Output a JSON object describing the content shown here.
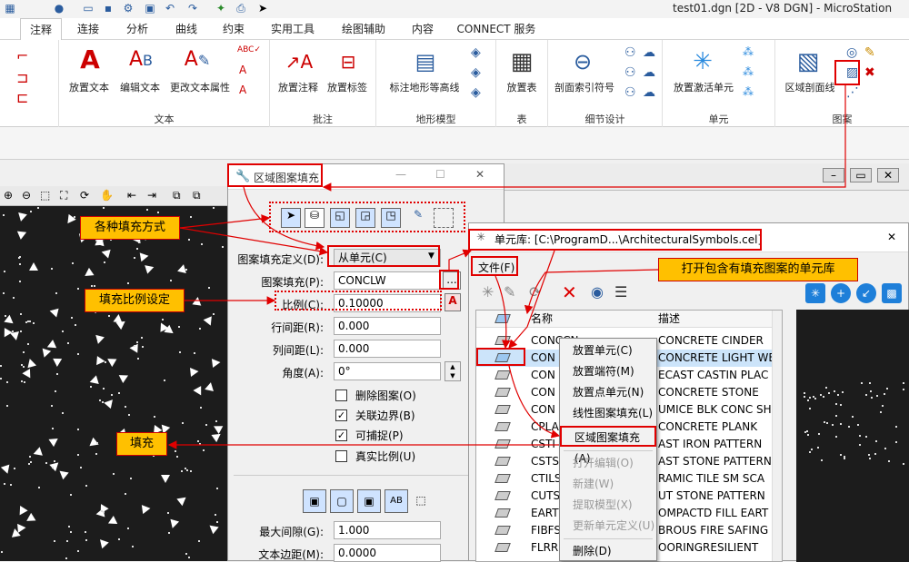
{
  "window": {
    "title": "test01.dgn [2D - V8 DGN] - MicroStation"
  },
  "tabs": [
    "注释",
    "连接",
    "分析",
    "曲线",
    "约束",
    "实用工具",
    "绘图辅助",
    "内容",
    "CONNECT 服务"
  ],
  "ribbon": {
    "text_group": {
      "label": "文本",
      "place_text": "放置文本",
      "edit_text": "编辑文本",
      "change_attr": "更改文本属性"
    },
    "dim_group": {
      "label": "批注",
      "place_note": "放置注释",
      "place_label": "放置标签"
    },
    "terrain_group": {
      "label": "地形模型",
      "contour": "标注地形等高线"
    },
    "table_group": {
      "label": "表",
      "place_table": "放置表"
    },
    "detail_group": {
      "label": "细节设计",
      "section_marker": "剖面索引符号"
    },
    "cell_group": {
      "label": "单元",
      "place_active_cell": "放置激活单元"
    },
    "pattern_group": {
      "label": "图案",
      "area_pattern": "区域剖面线"
    }
  },
  "dialog": {
    "title": "区域图案填充",
    "fields": {
      "pattern_def_label": "图案填充定义(D):",
      "pattern_def_value": "从单元(C)",
      "pattern_label": "图案填充(P):",
      "pattern_value": "CONCLW",
      "browse": "...",
      "scale_label": "比例(C):",
      "scale_value": "0.10000",
      "row_spacing_label": "行间距(R):",
      "row_spacing_value": "0.000",
      "col_spacing_label": "列间距(L):",
      "col_spacing_value": "0.000",
      "angle_label": "角度(A):",
      "angle_value": "0°",
      "max_gap_label": "最大间隙(G):",
      "max_gap_value": "1.000",
      "text_margin_label": "文本边距(M):",
      "text_margin_value": "0.0000"
    },
    "checkboxes": [
      {
        "label": "删除图案(O)",
        "checked": false
      },
      {
        "label": "关联边界(B)",
        "checked": true
      },
      {
        "label": "可捕捉(P)",
        "checked": true
      },
      {
        "label": "真实比例(U)",
        "checked": false
      }
    ]
  },
  "cell_library": {
    "title": "单元库: [C:\\ProgramD...\\ArchitecturalSymbols.cel]",
    "file_menu": "文件(F)",
    "columns": {
      "name": "名称",
      "desc": "描述"
    },
    "rows": [
      {
        "name": "CONCCN",
        "desc": "CONCRETE CINDER"
      },
      {
        "name": "CON",
        "desc": "CONCRETE LIGHT WE"
      },
      {
        "name": "CON",
        "desc": "ECAST CASTIN PLAC"
      },
      {
        "name": "CON",
        "desc": "CONCRETE STONE"
      },
      {
        "name": "CON",
        "desc": "UMICE BLK CONC SH"
      },
      {
        "name": "CPLA",
        "desc": "CONCRETE PLANK"
      },
      {
        "name": "CSTI",
        "desc": "AST IRON PATTERN"
      },
      {
        "name": "CSTS",
        "desc": "AST STONE PATTERN"
      },
      {
        "name": "CTILS",
        "desc": "RAMIC TILE SM SCA"
      },
      {
        "name": "CUTS",
        "desc": "UT STONE PATTERN"
      },
      {
        "name": "EART",
        "desc": "OMPACTD FILL EART"
      },
      {
        "name": "FIBFS",
        "desc": "BROUS FIRE SAFING"
      },
      {
        "name": "FLRR",
        "desc": "OORINGRESILIENT"
      }
    ]
  },
  "context_menu": [
    {
      "label": "放置单元(C)",
      "disabled": false
    },
    {
      "label": "放置端符(M)",
      "disabled": false
    },
    {
      "label": "放置点单元(N)",
      "disabled": false
    },
    {
      "label": "线性图案填充(L)",
      "disabled": false
    },
    {
      "label": "区域图案填充(A)",
      "disabled": false
    },
    {
      "label": "打开编辑(O)",
      "disabled": true
    },
    {
      "label": "新建(W)",
      "disabled": true
    },
    {
      "label": "提取模型(X)",
      "disabled": true
    },
    {
      "label": "更新单元定义(U)",
      "disabled": true
    },
    {
      "label": "删除(D)",
      "disabled": false
    }
  ],
  "annotations": {
    "fill_methods": "各种填充方式",
    "scale_setting": "填充比例设定",
    "fill": "填充",
    "open_library": "打开包含有填充图案的单元库"
  },
  "colors": {
    "callout_bg": "#ffc000",
    "annotation_red": "#e00000",
    "viewport_bg": "#1c1c1c"
  }
}
